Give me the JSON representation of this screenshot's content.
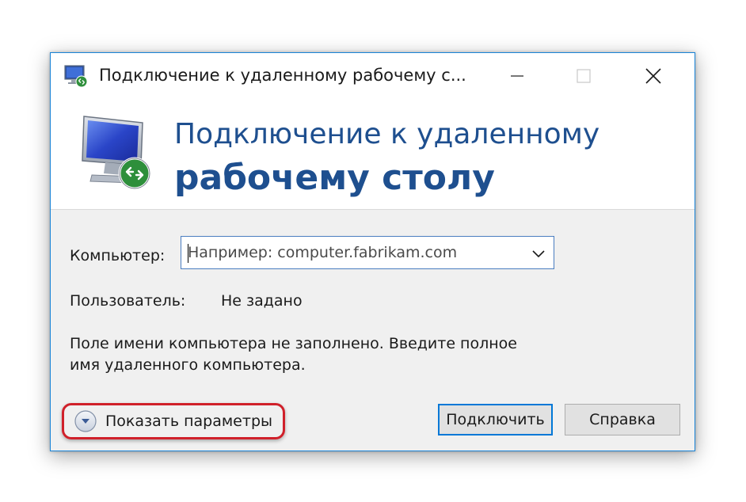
{
  "window": {
    "title": "Подключение к удаленному рабочему с..."
  },
  "banner": {
    "line1": "Подключение к удаленному",
    "line2": "рабочему столу"
  },
  "form": {
    "computer_label": "Компьютер:",
    "computer_placeholder": "Например: computer.fabrikam.com",
    "user_label": "Пользователь:",
    "user_value": "Не задано",
    "info_line1": "Поле имени компьютера не заполнено. Введите полное",
    "info_line2": "имя удаленного компьютера."
  },
  "footer": {
    "show_options_label": "Показать параметры",
    "connect_label": "Подключить",
    "help_label": "Справка"
  },
  "colors": {
    "accent": "#1883d7",
    "banner_text": "#1e4f8f",
    "highlight": "#d0202a"
  },
  "icons": {
    "app": "remote-desktop-icon",
    "minimize": "minimize-icon",
    "maximize": "maximize-icon",
    "close": "close-icon",
    "dropdown": "chevron-down-icon",
    "options": "expand-circle-icon"
  }
}
